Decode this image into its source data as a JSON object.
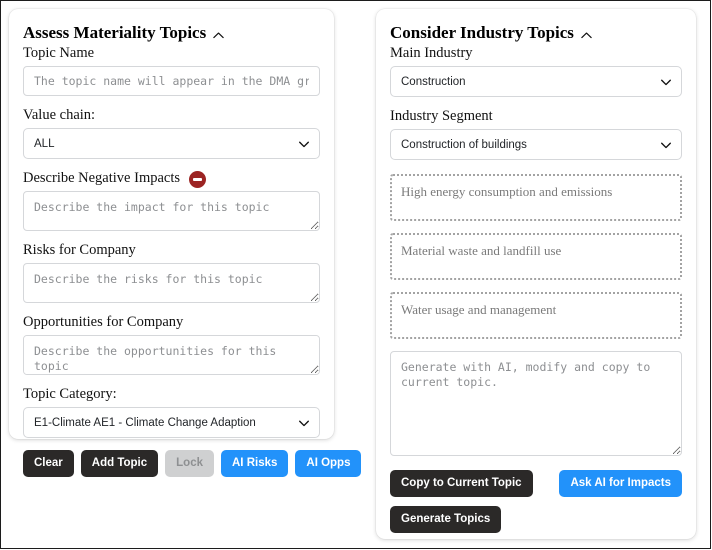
{
  "left_panel": {
    "title": "Assess Materiality Topics",
    "collapse_icon": "chevron-up-icon",
    "topic_name_label": "Topic Name",
    "topic_name_placeholder": "The topic name will appear in the DMA graph",
    "topic_name_value": "",
    "value_chain_label": "Value chain:",
    "value_chain_value": "ALL",
    "value_chain_options": [
      "ALL"
    ],
    "negative_impacts_label": "Describe Negative Impacts",
    "negative_impacts_icon": "no-entry-icon",
    "negative_impacts_placeholder": "Describe the impact for this topic",
    "negative_impacts_value": "",
    "risks_label": "Risks for Company",
    "risks_placeholder": "Describe the risks for this topic",
    "risks_value": "",
    "opportunities_label": "Opportunities for Company",
    "opportunities_placeholder": "Describe the opportunities for this topic",
    "opportunities_value": "",
    "topic_category_label": "Topic Category:",
    "topic_category_value": "E1-Climate AE1 - Climate Change Adaption",
    "topic_category_options": [
      "E1-Climate AE1 - Climate Change Adaption"
    ],
    "buttons": {
      "clear": "Clear",
      "add_topic": "Add Topic",
      "lock": "Lock",
      "ai_risks": "AI Risks",
      "ai_opps": "AI Opps"
    }
  },
  "right_panel": {
    "title": "Consider Industry Topics",
    "collapse_icon": "chevron-up-icon",
    "main_industry_label": "Main Industry",
    "main_industry_value": "Construction",
    "main_industry_options": [
      "Construction"
    ],
    "industry_segment_label": "Industry Segment",
    "industry_segment_value": "Construction of buildings",
    "industry_segment_options": [
      "Construction of buildings"
    ],
    "suggested_topics": [
      "High energy consumption and emissions",
      "Material waste and landfill use",
      "Water usage and management"
    ],
    "ai_textarea_placeholder": "Generate with AI, modify and copy to current topic.",
    "ai_textarea_value": "",
    "buttons": {
      "copy_to_current_topic": "Copy to Current Topic",
      "ask_ai_for_impacts": "Ask AI for Impacts",
      "generate_topics": "Generate Topics"
    }
  },
  "colors": {
    "accent_blue": "#2292fa",
    "dark_button": "#2b2928",
    "disabled_button": "#cfd0d1",
    "no_entry_red": "#9c2423",
    "dotted_border": "#a3a3a3"
  }
}
